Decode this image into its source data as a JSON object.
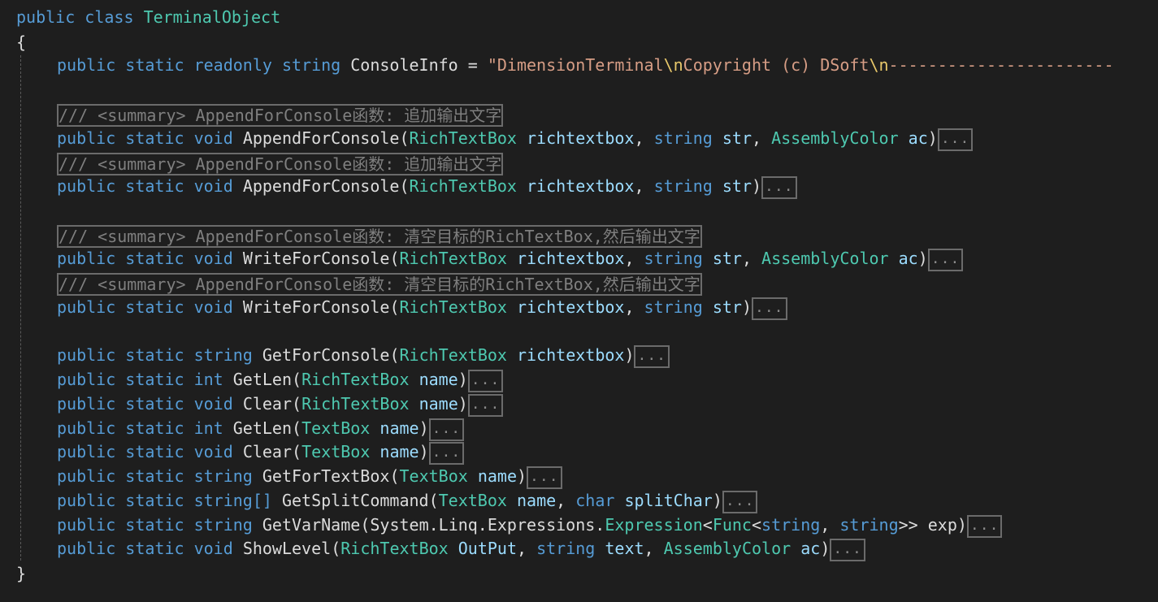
{
  "code": {
    "class_decl": {
      "modifier": "public",
      "keyword": "class",
      "name": "TerminalObject"
    },
    "open_brace": "{",
    "close_brace": "}",
    "field": {
      "mods": "public static readonly",
      "type": "string",
      "name": "ConsoleInfo",
      "eq": " = ",
      "value_start": "\"DimensionTerminal",
      "esc1": "\\n",
      "value_mid": "Copyright (c) DSoft",
      "esc2": "\\n",
      "value_end": "-----------------------"
    },
    "summary_append": "/// <summary> AppendForConsole函数: 追加输出文字",
    "summary_write": "/// <summary> AppendForConsole函数: 清空目标的RichTextBox,然后输出文字",
    "collapsed": "...",
    "methods": [
      {
        "mods": "public static",
        "ret": "void",
        "name": "AppendForConsole",
        "params": [
          {
            "type": "RichTextBox",
            "type_kind": "type",
            "name": "richtextbox"
          },
          {
            "type": "string",
            "type_kind": "kw",
            "name": "str"
          },
          {
            "type": "AssemblyColor",
            "type_kind": "type",
            "name": "ac"
          }
        ]
      },
      {
        "mods": "public static",
        "ret": "void",
        "name": "AppendForConsole",
        "params": [
          {
            "type": "RichTextBox",
            "type_kind": "type",
            "name": "richtextbox"
          },
          {
            "type": "string",
            "type_kind": "kw",
            "name": "str"
          }
        ]
      },
      {
        "mods": "public static",
        "ret": "void",
        "name": "WriteForConsole",
        "params": [
          {
            "type": "RichTextBox",
            "type_kind": "type",
            "name": "richtextbox"
          },
          {
            "type": "string",
            "type_kind": "kw",
            "name": "str"
          },
          {
            "type": "AssemblyColor",
            "type_kind": "type",
            "name": "ac"
          }
        ]
      },
      {
        "mods": "public static",
        "ret": "void",
        "name": "WriteForConsole",
        "params": [
          {
            "type": "RichTextBox",
            "type_kind": "type",
            "name": "richtextbox"
          },
          {
            "type": "string",
            "type_kind": "kw",
            "name": "str"
          }
        ]
      },
      {
        "mods": "public static",
        "ret": "string",
        "name": "GetForConsole",
        "params": [
          {
            "type": "RichTextBox",
            "type_kind": "type",
            "name": "richtextbox"
          }
        ]
      },
      {
        "mods": "public static",
        "ret": "int",
        "name": "GetLen",
        "params": [
          {
            "type": "RichTextBox",
            "type_kind": "type",
            "name": "name"
          }
        ]
      },
      {
        "mods": "public static",
        "ret": "void",
        "name": "Clear",
        "params": [
          {
            "type": "RichTextBox",
            "type_kind": "type",
            "name": "name"
          }
        ]
      },
      {
        "mods": "public static",
        "ret": "int",
        "name": "GetLen",
        "params": [
          {
            "type": "TextBox",
            "type_kind": "type",
            "name": "name"
          }
        ]
      },
      {
        "mods": "public static",
        "ret": "void",
        "name": "Clear",
        "params": [
          {
            "type": "TextBox",
            "type_kind": "type",
            "name": "name"
          }
        ]
      },
      {
        "mods": "public static",
        "ret": "string",
        "name": "GetForTextBox",
        "params": [
          {
            "type": "TextBox",
            "type_kind": "type",
            "name": "name"
          }
        ]
      },
      {
        "mods": "public static",
        "ret": "string[]",
        "name": "GetSplitCommand",
        "params": [
          {
            "type": "TextBox",
            "type_kind": "type",
            "name": "name"
          },
          {
            "type": "char",
            "type_kind": "kw",
            "name": "splitChar"
          }
        ]
      },
      {
        "mods": "public static",
        "ret": "string",
        "name": "GetVarName",
        "params": [
          {
            "type": "System.Linq.Expressions.",
            "type_kind": "plain",
            "name": "",
            "generic": {
              "outer": "Expression",
              "inner": "Func",
              "args": "string",
              "args2": "string",
              "close": ">> "
            },
            "name2": "exp"
          }
        ]
      },
      {
        "mods": "public static",
        "ret": "void",
        "name": "ShowLevel",
        "params": [
          {
            "type": "RichTextBox",
            "type_kind": "type",
            "name": "OutPut"
          },
          {
            "type": "string",
            "type_kind": "kw",
            "name": "text"
          },
          {
            "type": "AssemblyColor",
            "type_kind": "type",
            "name": "ac"
          }
        ]
      }
    ]
  },
  "colors": {
    "background": "#1e1e1e",
    "keyword": "#569cd6",
    "type": "#4ec9b0",
    "identifier": "#dcdcdc",
    "parameter": "#9cdcfe",
    "string": "#d69d85",
    "comment": "#7f7f7f"
  }
}
